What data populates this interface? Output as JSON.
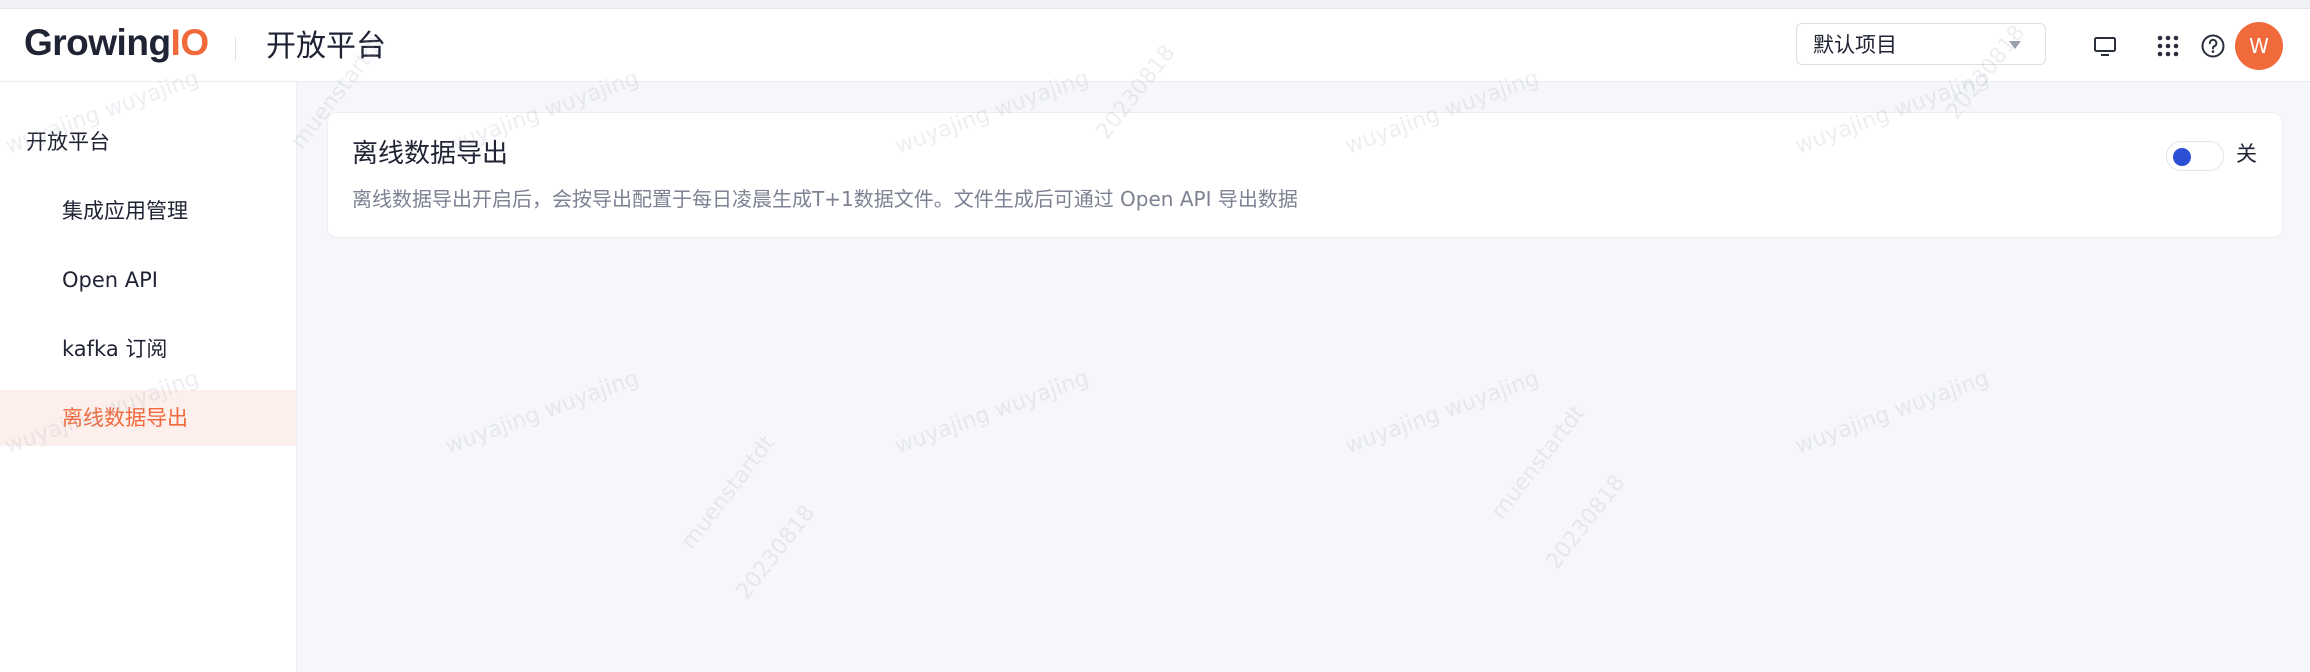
{
  "header": {
    "logo_main": "Growing",
    "logo_accent": "IO",
    "title": "开放平台",
    "project_select": {
      "value": "默认项目"
    },
    "icons": [
      "monitor-icon",
      "apps-grid-icon",
      "help-icon"
    ],
    "avatar_initial": "W"
  },
  "sidebar": {
    "section_title": "开放平台",
    "items": [
      {
        "label": "集成应用管理",
        "active": false
      },
      {
        "label": "Open API",
        "active": false
      },
      {
        "label": "kafka 订阅",
        "active": false
      },
      {
        "label": "离线数据导出",
        "active": true
      }
    ]
  },
  "main": {
    "card": {
      "title": "离线数据导出",
      "description": "离线数据导出开启后，会按导出配置于每日凌晨生成T+1数据文件。文件生成后可通过 Open API 导出数据",
      "toggle_on": false,
      "toggle_label": "关"
    }
  },
  "watermark": {
    "text_user": "wuyajing wuyajing",
    "text_id": "muenstartdt",
    "text_date": "20230818"
  },
  "colors": {
    "accent": "#f06a3c",
    "toggle_knob": "#2d4fd6",
    "active_bg": "#fdf0ec",
    "background": "#f6f7fa"
  }
}
